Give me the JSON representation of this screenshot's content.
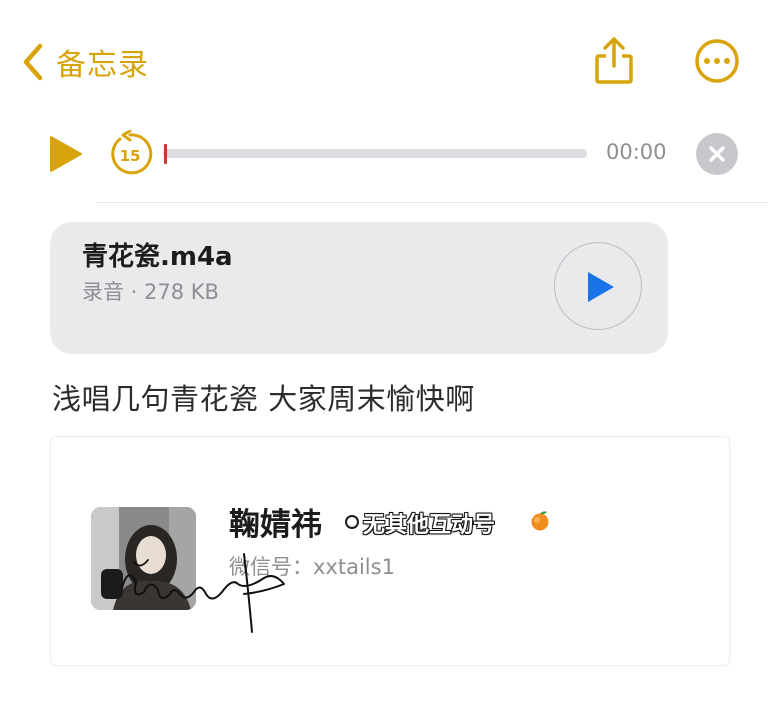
{
  "nav": {
    "back_label": "备忘录",
    "icons": {
      "back": "chevron-left-icon",
      "share": "share-icon",
      "more": "more-ellipsis-icon"
    }
  },
  "player": {
    "time": "00:00",
    "skip_seconds": "15",
    "progress": 0,
    "icons": {
      "play": "play-icon",
      "skip": "skip-back-15-icon",
      "close": "close-icon"
    }
  },
  "attachment": {
    "name": "青花瓷.m4a",
    "meta": "录音 · 278 KB",
    "icons": {
      "play": "play-icon"
    }
  },
  "note": {
    "body": "浅唱几句青花瓷 大家周末愉快啊"
  },
  "profile": {
    "name": "鞠婧祎",
    "tag": "无其他互动号",
    "wechat": "微信号：xxtails1",
    "icons": {
      "avatar": "avatar-photo",
      "tag_emoji": "peach-icon",
      "signature": "handwritten-signature"
    }
  },
  "colors": {
    "accent": "#d9a40b",
    "scrub_head": "#c0392b",
    "attachment_play": "#1a73e8",
    "card_bg": "#eaeaec",
    "secondary_text": "#8e8e93"
  }
}
